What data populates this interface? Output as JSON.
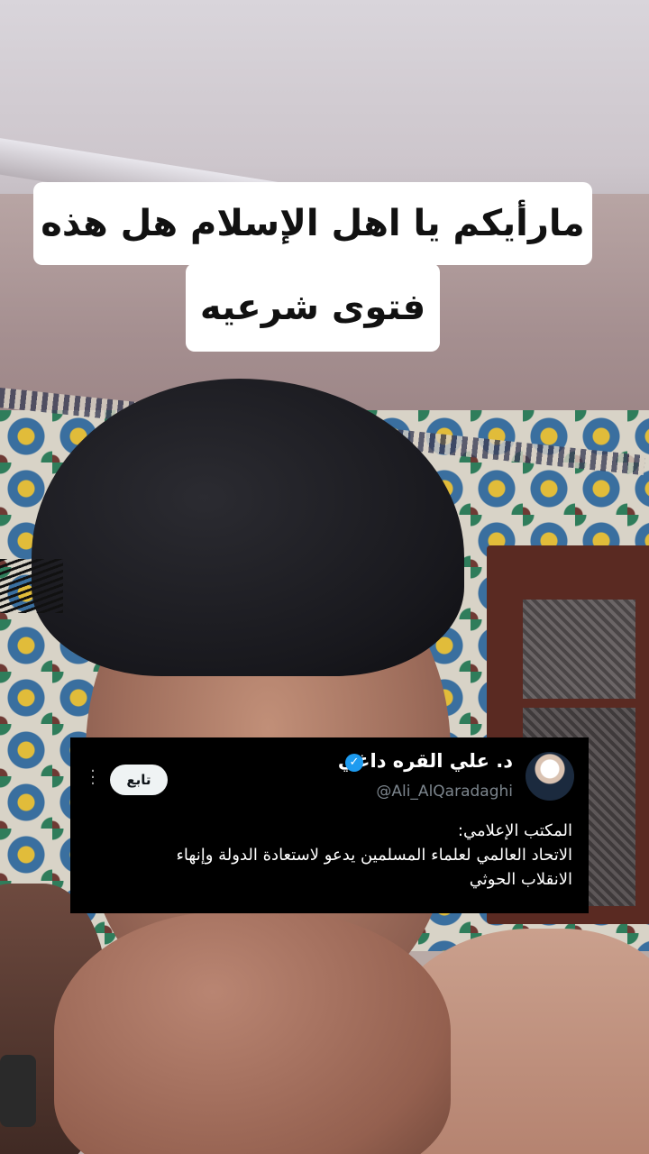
{
  "caption": {
    "line1": "مارأيكم يا اهل الإسلام هل هذه",
    "line2": "فتوى شرعيه"
  },
  "tweet": {
    "author_name": "د. علي القره داغي",
    "handle": "@Ali_AlQaradaghi",
    "follow_label": "تابع",
    "line1": "المكتب الإعلامي:",
    "line2": "الاتحاد العالمي لعلماء المسلمين يدعو لاستعادة الدولة وإنهاء",
    "line3": "الانقلاب الحوثي"
  },
  "icons": {
    "verified": "verified-badge-icon",
    "more": "more-vertical-icon"
  },
  "colors": {
    "caption_bg": "#ffffff",
    "tweet_bg": "#000000",
    "verified": "#1d9bf0",
    "handle": "#7c858d"
  }
}
